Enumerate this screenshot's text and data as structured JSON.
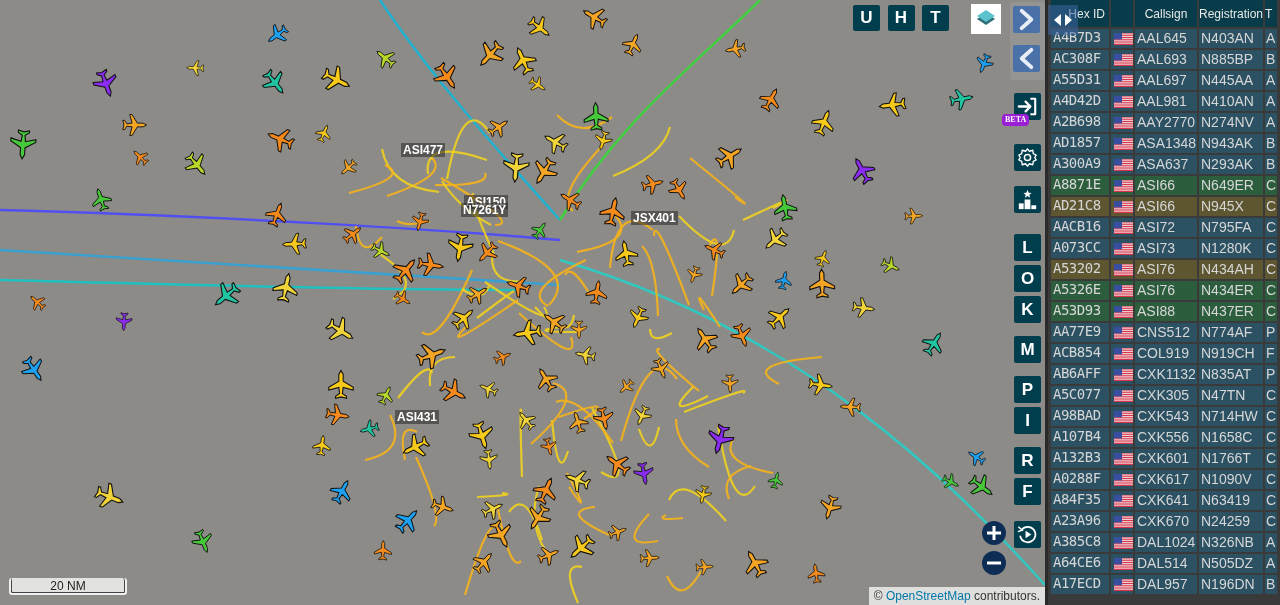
{
  "map": {
    "top_buttons": [
      {
        "label": "U"
      },
      {
        "label": "H"
      },
      {
        "label": "T"
      }
    ],
    "side_buttons": [
      {
        "label": "L"
      },
      {
        "label": "O"
      },
      {
        "label": "K"
      },
      {
        "label": "M"
      },
      {
        "label": "P"
      },
      {
        "label": "I"
      },
      {
        "label": "R"
      },
      {
        "label": "F"
      }
    ],
    "beta_badge": "BETA",
    "aircraft_labels": [
      {
        "text": "ASI477"
      },
      {
        "text": "ASI150"
      },
      {
        "text": "N7261Y"
      },
      {
        "text": "JSX401"
      },
      {
        "text": "ASI431"
      }
    ],
    "scale": "20 NM",
    "attribution": {
      "before": "©",
      "link": "OpenStreetMap",
      "after": "contributors."
    }
  },
  "table": {
    "columns": [
      "Hex ID",
      "Callsign",
      "Registration",
      "T"
    ],
    "rows": [
      {
        "hex": "A4B7D3",
        "callsign": "AAL645",
        "registration": "N403AN",
        "column_5": "A",
        "color": "#2b5163"
      },
      {
        "hex": "AC308F",
        "callsign": "AAL693",
        "registration": "N885BP",
        "column_5": "B",
        "color": "#2b5163"
      },
      {
        "hex": "A55D31",
        "callsign": "AAL697",
        "registration": "N445AA",
        "column_5": "A",
        "color": "#2b5163"
      },
      {
        "hex": "A4D42D",
        "callsign": "AAL981",
        "registration": "N410AN",
        "column_5": "A",
        "color": "#2b5163"
      },
      {
        "hex": "A2B698",
        "callsign": "AAY2770",
        "registration": "N274NV",
        "column_5": "A",
        "color": "#2b5163"
      },
      {
        "hex": "AD1857",
        "callsign": "ASA1348",
        "registration": "N943AK",
        "column_5": "B",
        "color": "#2b5163"
      },
      {
        "hex": "A300A9",
        "callsign": "ASA637",
        "registration": "N293AK",
        "column_5": "B",
        "color": "#2b5163"
      },
      {
        "hex": "A8871E",
        "callsign": "ASI66",
        "registration": "N649ER",
        "column_5": "C",
        "color": "#2c5e3e"
      },
      {
        "hex": "AD21C8",
        "callsign": "ASI66",
        "registration": "N945X",
        "column_5": "C",
        "color": "#5d5631"
      },
      {
        "hex": "AACB16",
        "callsign": "ASI72",
        "registration": "N795FA",
        "column_5": "C",
        "color": "#2b5163"
      },
      {
        "hex": "A073CC",
        "callsign": "ASI73",
        "registration": "N1280K",
        "column_5": "C",
        "color": "#2b5163"
      },
      {
        "hex": "A53202",
        "callsign": "ASI76",
        "registration": "N434AH",
        "column_5": "C",
        "color": "#5d5631"
      },
      {
        "hex": "A5326E",
        "callsign": "ASI76",
        "registration": "N434ER",
        "column_5": "C",
        "color": "#2c5e3e"
      },
      {
        "hex": "A53D93",
        "callsign": "ASI88",
        "registration": "N437ER",
        "column_5": "C",
        "color": "#2c5e3e"
      },
      {
        "hex": "AA77E9",
        "callsign": "CNS512",
        "registration": "N774AF",
        "column_5": "P",
        "color": "#2b5163"
      },
      {
        "hex": "ACB854",
        "callsign": "COL919",
        "registration": "N919CH",
        "column_5": "F",
        "color": "#2b5163"
      },
      {
        "hex": "AB6AFF",
        "callsign": "CXK1132",
        "registration": "N835AT",
        "column_5": "P",
        "color": "#2b5163"
      },
      {
        "hex": "A5C077",
        "callsign": "CXK305",
        "registration": "N47TN",
        "column_5": "C",
        "color": "#2b5163"
      },
      {
        "hex": "A98BAD",
        "callsign": "CXK543",
        "registration": "N714HW",
        "column_5": "C",
        "color": "#2b5163"
      },
      {
        "hex": "A107B4",
        "callsign": "CXK556",
        "registration": "N1658C",
        "column_5": "C",
        "color": "#2b5163"
      },
      {
        "hex": "A132B3",
        "callsign": "CXK601",
        "registration": "N1766T",
        "column_5": "C",
        "color": "#2b5163"
      },
      {
        "hex": "A0288F",
        "callsign": "CXK617",
        "registration": "N1090V",
        "column_5": "C",
        "color": "#2b5163"
      },
      {
        "hex": "A84F35",
        "callsign": "CXK641",
        "registration": "N63419",
        "column_5": "C",
        "color": "#2b5163"
      },
      {
        "hex": "A23A96",
        "callsign": "CXK670",
        "registration": "N24259",
        "column_5": "C",
        "color": "#2b5163"
      },
      {
        "hex": "A385C8",
        "callsign": "DAL1024",
        "registration": "N326NB",
        "column_5": "A",
        "color": "#2b5163"
      },
      {
        "hex": "A64CE6",
        "callsign": "DAL514",
        "registration": "N505DZ",
        "column_5": "A",
        "color": "#2b5163"
      },
      {
        "hex": "A17ECD",
        "callsign": "DAL957",
        "registration": "N196DN",
        "column_5": "B",
        "color": "#2b5163"
      }
    ]
  }
}
